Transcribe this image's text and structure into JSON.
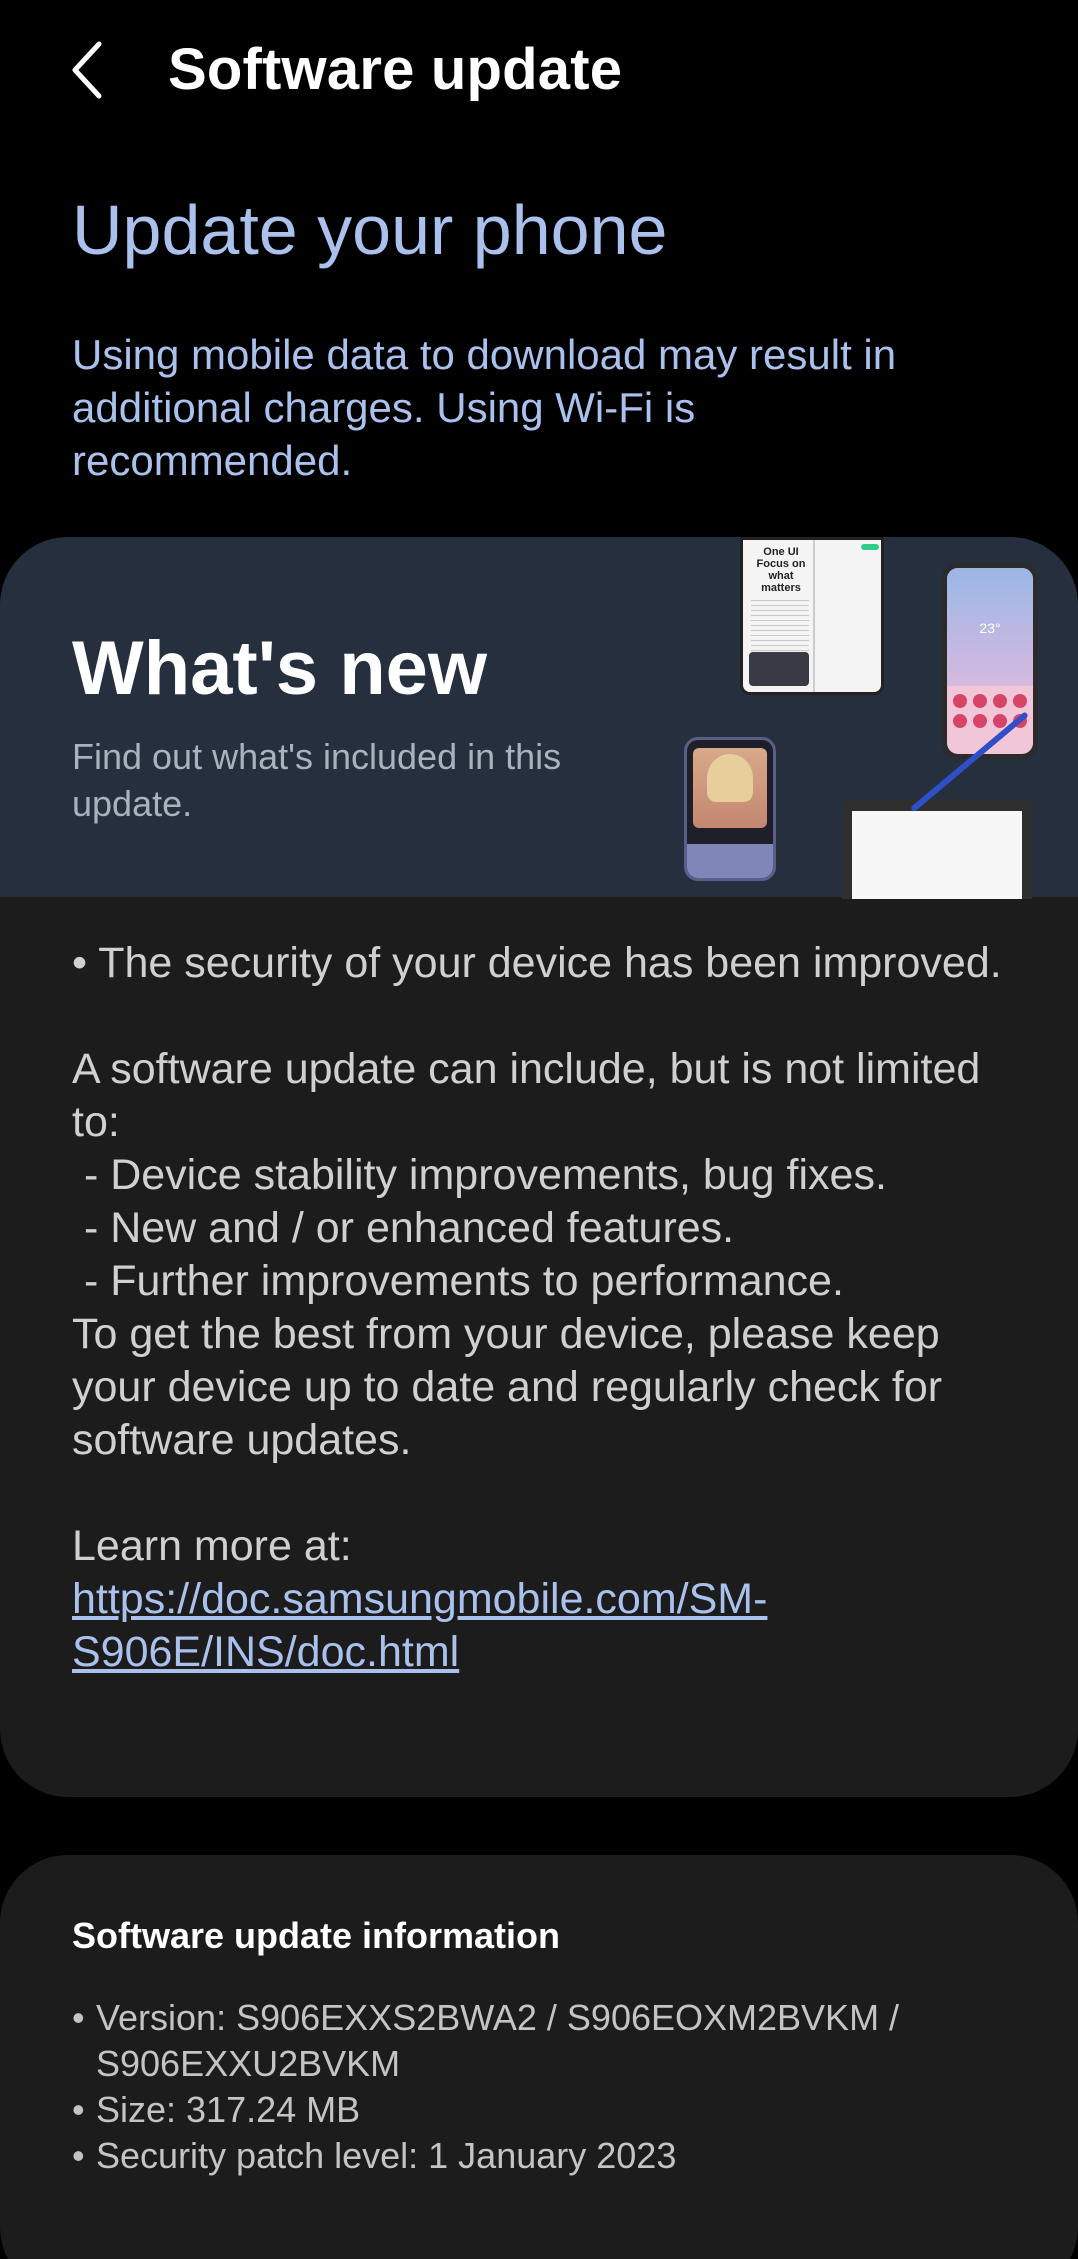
{
  "header": {
    "back_icon": "chevron-left-icon",
    "title": "Software update"
  },
  "hero": {
    "title": "Update your phone",
    "notice": "Using mobile data to download may result in additional charges. Using Wi-Fi is recommended."
  },
  "whats_new": {
    "title": "What's new",
    "subtitle": "Find out what's included in this update.",
    "illustration_text": {
      "brand": "One UI",
      "tagline": "Focus on what matters",
      "clock": "23°"
    },
    "notes_intro": "• The security of your device has been improved.\n\nA software update can include, but is not limited to:\n - Device stability improvements, bug fixes.\n - New and / or enhanced features.\n - Further improvements to performance.\nTo get the best from your device, please keep your device up to date and regularly check for software updates.\n\nLearn more at:\n",
    "link": "https://doc.samsungmobile.com/SM-S906E/INS/doc.html"
  },
  "info": {
    "title": "Software update information",
    "items": [
      "Version: S906EXXS2BWA2 / S906EOXM2BVKM / S906EXXU2BVKM",
      "Size: 317.24 MB",
      "Security patch level: 1 January 2023"
    ]
  },
  "colors": {
    "background": "#000000",
    "accent_text": "#a9c1ec",
    "card": "#1c1c1c",
    "banner": "#252f3d"
  }
}
